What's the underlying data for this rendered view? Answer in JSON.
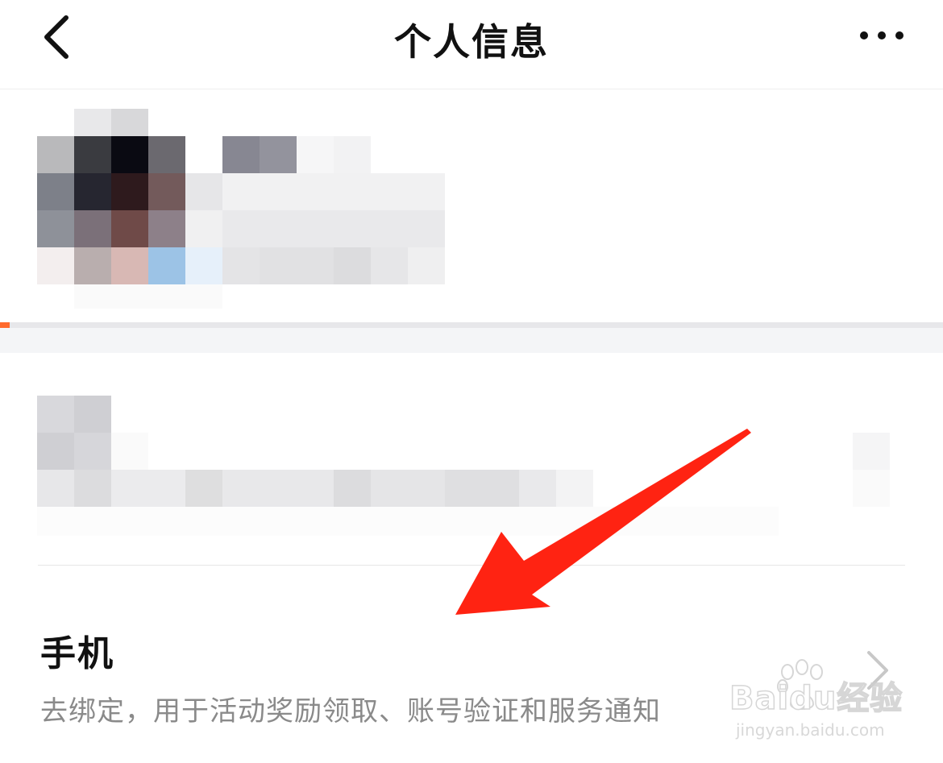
{
  "header": {
    "title": "个人信息",
    "back_icon": "chevron-left-icon",
    "more_icon": "more-horizontal-icon"
  },
  "profile": {
    "progress_fraction": 0.01,
    "progress_color": "#ff6a2d"
  },
  "phone_row": {
    "title": "手机",
    "description": "去绑定，用于活动奖励领取、账号验证和服务通知",
    "chevron_icon": "chevron-right-icon"
  },
  "annotation": {
    "arrow_color": "#ff2312"
  },
  "watermark": {
    "brand": "Baidu经验",
    "url": "jingyan.baidu.com"
  }
}
